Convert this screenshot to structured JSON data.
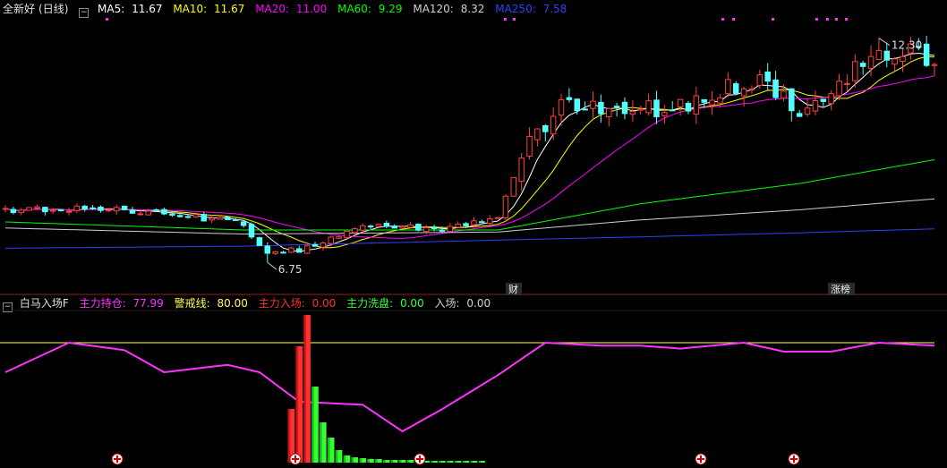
{
  "top_legend": {
    "stock": "全新好",
    "period": "(日线)",
    "ma5": {
      "label": "MA5:",
      "value": "11.67",
      "color": "#ffffff"
    },
    "ma10": {
      "label": "MA10:",
      "value": "11.67",
      "color": "#ffff00"
    },
    "ma20": {
      "label": "MA20:",
      "value": "11.00",
      "color": "#ff00ff"
    },
    "ma60": {
      "label": "MA60:",
      "value": "9.29",
      "color": "#00ff00"
    },
    "ma120": {
      "label": "MA120:",
      "value": "8.32",
      "color": "#d0d0d0"
    },
    "ma250": {
      "label": "MA250:",
      "value": "7.58",
      "color": "#3040ff"
    }
  },
  "bottom_legend": {
    "indicator": "白马入场F",
    "items": [
      {
        "label": "主力持仓:",
        "value": "77.99",
        "color": "#ff33ff"
      },
      {
        "label": "警戒线:",
        "value": "80.00",
        "color": "#ffff55"
      },
      {
        "label": "主力入场:",
        "value": "0.00",
        "color": "#ff3030"
      },
      {
        "label": "主力洗盘:",
        "value": "0.00",
        "color": "#33ff33"
      },
      {
        "label": "入场:",
        "value": "0.00",
        "color": "#d0d0d0"
      }
    ]
  },
  "price_labels": {
    "high": "12.30",
    "low": "6.75"
  },
  "event_tags": {
    "cai": "财",
    "zhangbang": "涨榜"
  },
  "colors": {
    "up": "#ff4040",
    "down": "#54ffff",
    "bg": "#000000"
  },
  "chart_data": [
    {
      "type": "candlestick",
      "ylim": [
        6.2,
        12.8
      ],
      "n": 118,
      "high_marker": {
        "value": 12.3
      },
      "low_marker": {
        "value": 6.75
      },
      "seed": 20240517,
      "anchors": [
        [
          0,
          8.05
        ],
        [
          10,
          8.1
        ],
        [
          20,
          8.0
        ],
        [
          30,
          7.7
        ],
        [
          33,
          6.95
        ],
        [
          38,
          7.1
        ],
        [
          45,
          7.7
        ],
        [
          55,
          7.55
        ],
        [
          62,
          7.85
        ],
        [
          65,
          9.4
        ],
        [
          70,
          10.6
        ],
        [
          78,
          10.55
        ],
        [
          86,
          10.55
        ],
        [
          90,
          11.05
        ],
        [
          95,
          11.2
        ],
        [
          100,
          10.6
        ],
        [
          105,
          11.2
        ],
        [
          110,
          11.9
        ],
        [
          114,
          12.05
        ],
        [
          117,
          11.6
        ]
      ],
      "series": [
        {
          "name": "MA5",
          "color": "#ffffff",
          "period": 5
        },
        {
          "name": "MA10",
          "color": "#ffff00",
          "period": 10
        },
        {
          "name": "MA20",
          "color": "#ff00ff",
          "period": 20
        },
        {
          "name": "MA60",
          "color": "#00ff00",
          "period": 60
        },
        {
          "name": "MA120",
          "color": "#d0d0d0",
          "period": 120
        },
        {
          "name": "MA250",
          "color": "#3040ff",
          "period": 250
        }
      ]
    },
    {
      "type": "line",
      "ylim": [
        0,
        100
      ],
      "series": [
        {
          "name": "主力持仓",
          "color": "#ff33ff",
          "anchors": [
            [
              0,
              60
            ],
            [
              8,
              80
            ],
            [
              15,
              75
            ],
            [
              20,
              60
            ],
            [
              28,
              65
            ],
            [
              32,
              60
            ],
            [
              37,
              40
            ],
            [
              45,
              38
            ],
            [
              50,
              20
            ],
            [
              55,
              35
            ],
            [
              62,
              58
            ],
            [
              68,
              80
            ],
            [
              75,
              78
            ],
            [
              80,
              78
            ],
            [
              85,
              76
            ],
            [
              93,
              80
            ],
            [
              98,
              74
            ],
            [
              104,
              74
            ],
            [
              110,
              80
            ],
            [
              117,
              78
            ]
          ]
        },
        {
          "name": "警戒线",
          "color": "#ffff55",
          "value": 80
        }
      ]
    },
    {
      "type": "bar",
      "series": [
        {
          "name": "主力入场",
          "color": "#ff3030",
          "x": [
            36,
            37,
            38
          ],
          "values": [
            60,
            130,
            165
          ]
        },
        {
          "name": "主力洗盘",
          "color": "#33ff33",
          "x": [
            39,
            40,
            41,
            42,
            43,
            44,
            45,
            46,
            47,
            48,
            49,
            50,
            51,
            52,
            53,
            54,
            55,
            56,
            57,
            58,
            59,
            60
          ],
          "values": [
            85,
            45,
            28,
            14,
            8,
            6,
            5,
            4,
            4,
            3,
            3,
            3,
            3,
            2,
            2,
            2,
            2,
            2,
            2,
            2,
            2,
            2
          ]
        }
      ]
    }
  ]
}
